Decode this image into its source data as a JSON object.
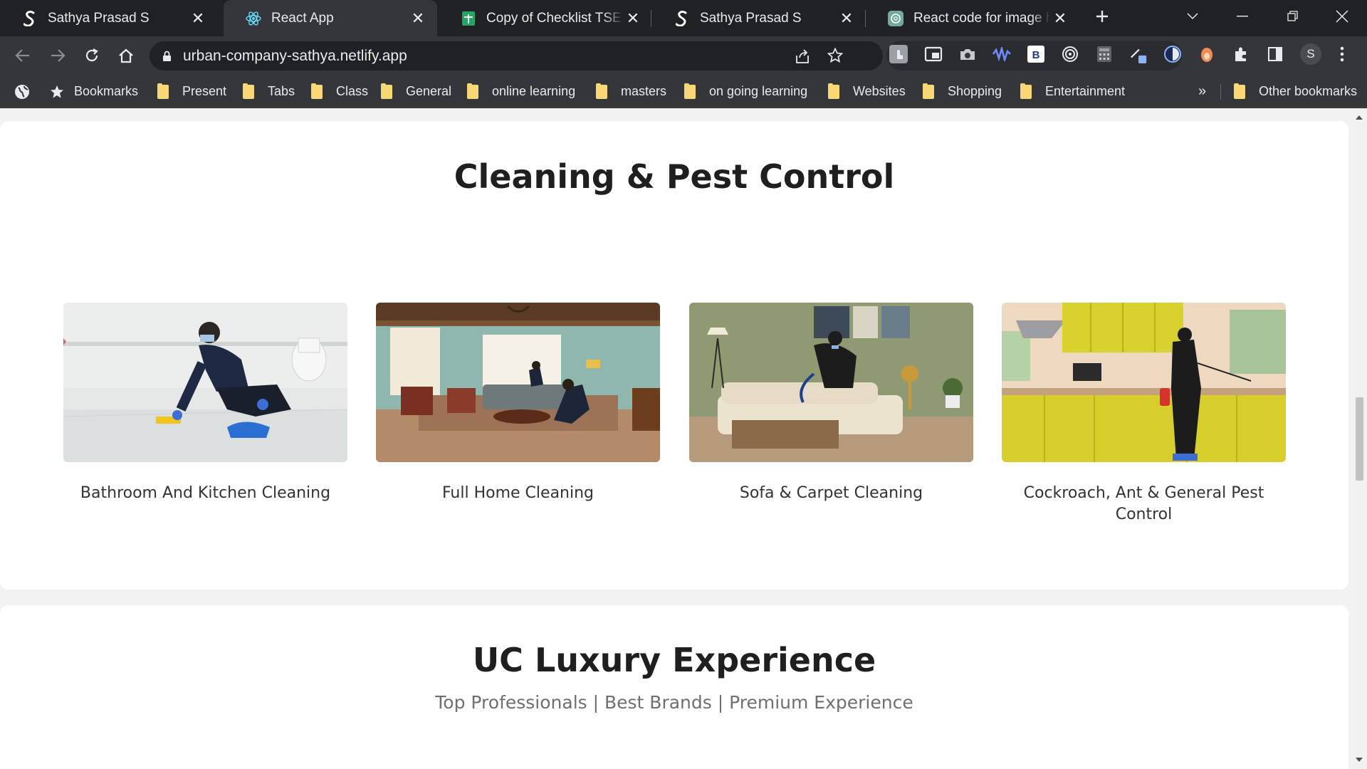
{
  "browser": {
    "tabs": [
      {
        "title": "Sathya Prasad S",
        "icon": "s-logo-icon",
        "active": false
      },
      {
        "title": "React App",
        "icon": "react-icon",
        "active": true
      },
      {
        "title": "Copy of Checklist TSE Bat",
        "icon": "sheets-icon",
        "active": false
      },
      {
        "title": "Sathya Prasad S",
        "icon": "s-logo-icon",
        "active": false
      },
      {
        "title": "React code for image hov",
        "icon": "chatgpt-icon",
        "active": false
      }
    ],
    "url": "urban-company-sathya.netlify.app",
    "profile_initial": "S",
    "bookmarks": {
      "bookmarks_label": "Bookmarks",
      "folders": [
        "Present",
        "Tabs",
        "Class",
        "General",
        "online learning",
        "masters",
        "on going learning",
        "Websites",
        "Shopping",
        "Entertainment"
      ],
      "overflow": "»",
      "other": "Other bookmarks"
    }
  },
  "page": {
    "cleaning": {
      "title": "Cleaning & Pest Control",
      "services": [
        {
          "label": "Bathroom And Kitchen Cleaning"
        },
        {
          "label": "Full Home Cleaning"
        },
        {
          "label": "Sofa & Carpet Cleaning"
        },
        {
          "label": "Cockroach, Ant & General Pest Control"
        }
      ]
    },
    "luxury": {
      "title": "UC Luxury Experience",
      "subtitle": "Top Professionals | Best Brands | Premium Experience"
    }
  },
  "colors": {
    "chrome_dark": "#202124",
    "chrome_toolbar": "#35363a",
    "page_bg": "#f2f2f2",
    "card_bg": "#ffffff",
    "heading": "#1f1f1f"
  }
}
